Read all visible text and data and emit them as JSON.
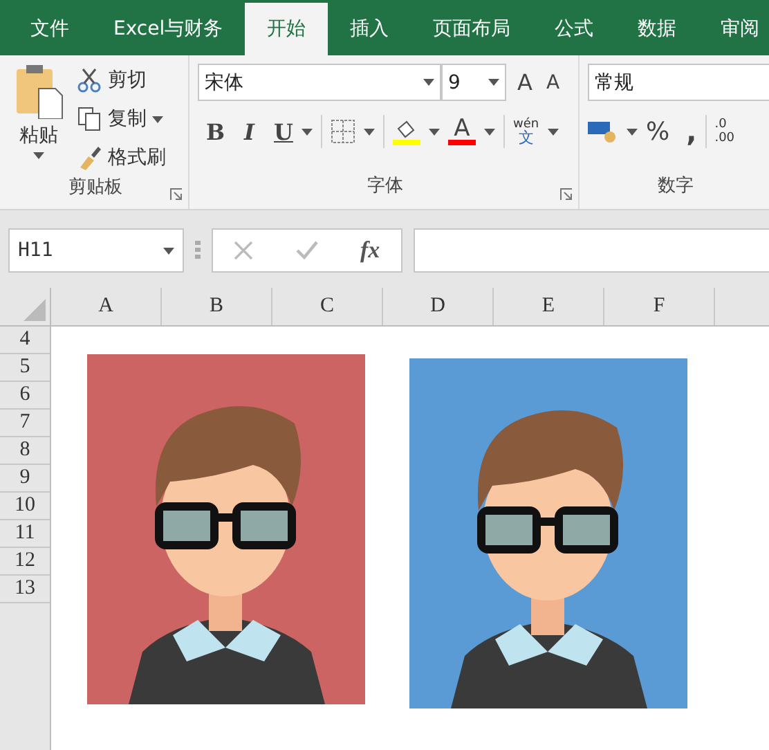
{
  "tabs": [
    {
      "label": "文件",
      "selected": false
    },
    {
      "label": "Excel与财务",
      "selected": false
    },
    {
      "label": "开始",
      "selected": true
    },
    {
      "label": "插入",
      "selected": false
    },
    {
      "label": "页面布局",
      "selected": false
    },
    {
      "label": "公式",
      "selected": false
    },
    {
      "label": "数据",
      "selected": false
    },
    {
      "label": "审阅",
      "selected": false
    }
  ],
  "clipboard": {
    "paste": "粘贴",
    "cut": "剪切",
    "copy": "复制",
    "format_painter": "格式刷",
    "group": "剪贴板"
  },
  "font": {
    "name": "宋体",
    "size": "9",
    "grow": "A",
    "shrink": "A",
    "bold": "B",
    "italic": "I",
    "underline": "U",
    "color_buttons": [
      {
        "kind": "fill",
        "color": "#ffff00"
      },
      {
        "kind": "font",
        "color": "#ff0000",
        "letter": "A"
      }
    ],
    "phonetic_top": "wén",
    "phonetic_bottom": "文",
    "group": "字体"
  },
  "number": {
    "format": "常规",
    "percent": "%",
    "comma": ",",
    "decimal_top": ".0",
    "decimal_bottom": ".00",
    "group": "数字"
  },
  "name_box": "H11",
  "function_label": "fx",
  "columns": [
    "A",
    "B",
    "C",
    "D",
    "E",
    "F"
  ],
  "rows": [
    "4",
    "5",
    "6",
    "7",
    "8",
    "9",
    "10",
    "11",
    "12",
    "13"
  ],
  "photos": [
    {
      "color": "#cd6464"
    },
    {
      "color": "#5b9bd5"
    }
  ]
}
